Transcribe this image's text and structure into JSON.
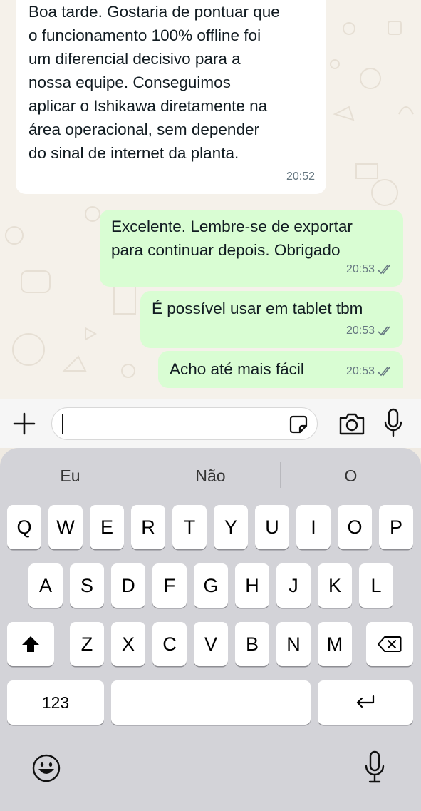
{
  "messages": [
    {
      "direction": "incoming",
      "text": "Boa tarde. Gostaria de pontuar que\no funcionamento 100% offline foi\num diferencial decisivo para a\nnossa equipe. Conseguimos\naplicar o Ishikawa diretamente na\nárea operacional, sem depender\ndo sinal de internet da planta.",
      "time": "20:52"
    },
    {
      "direction": "outgoing",
      "text": "Excelente. Lembre-se de exportar\npara continuar depois. Obrigado",
      "time": "20:53",
      "status": "read"
    },
    {
      "direction": "outgoing",
      "text": "É possível usar em tablet tbm",
      "time": "20:53",
      "status": "read"
    },
    {
      "direction": "outgoing",
      "text": "Acho até mais fácil",
      "time": "20:53",
      "status": "read"
    }
  ],
  "input_bar": {
    "plus_icon": "plus-icon",
    "value": "",
    "sticker_icon": "sticker-icon",
    "camera_icon": "camera-icon",
    "mic_icon": "microphone-icon"
  },
  "keyboard": {
    "suggestions": [
      "Eu",
      "Não",
      "O"
    ],
    "row1": [
      "Q",
      "W",
      "E",
      "R",
      "T",
      "Y",
      "U",
      "I",
      "O",
      "P"
    ],
    "row2": [
      "A",
      "S",
      "D",
      "F",
      "G",
      "H",
      "J",
      "K",
      "L"
    ],
    "row3": [
      "Z",
      "X",
      "C",
      "V",
      "B",
      "N",
      "M"
    ],
    "numbers_label": "123",
    "shift_icon": "shift-icon",
    "delete_icon": "delete-icon",
    "return_icon": "return-icon",
    "emoji_icon": "emoji-icon",
    "dictation_icon": "dictation-mic-icon"
  },
  "colors": {
    "chat_background": "#f5f1ea",
    "incoming_bubble": "#ffffff",
    "outgoing_bubble": "#d9fdd3",
    "read_ticks": "#667781",
    "keyboard_background": "#d3d3d8"
  }
}
